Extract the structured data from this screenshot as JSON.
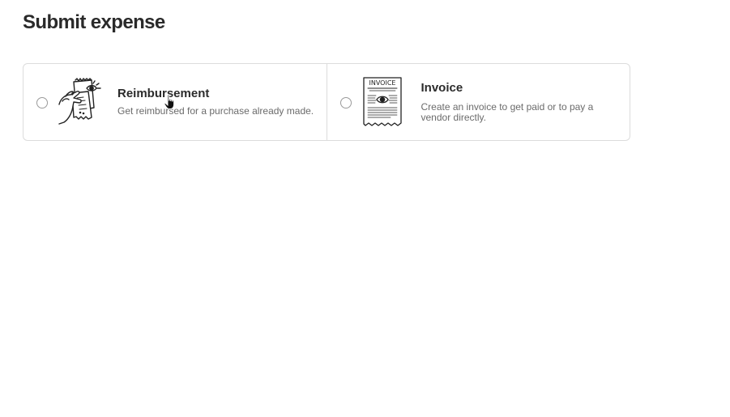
{
  "page": {
    "title": "Submit expense"
  },
  "options": [
    {
      "id": "reimbursement",
      "title": "Reimbursement",
      "description": "Get reimbursed for a purchase already made.",
      "icon": "hand-receipts-illustration",
      "selected": false
    },
    {
      "id": "invoice",
      "title": "Invoice",
      "description": "Create an invoice to get paid or to pay a vendor directly.",
      "icon": "invoice-document-illustration",
      "selected": false,
      "illustration_text": "INVOICE"
    }
  ],
  "colors": {
    "border": "#dcdcdc",
    "title_text": "#2a2a2a",
    "description_text": "#6b6b6b"
  }
}
